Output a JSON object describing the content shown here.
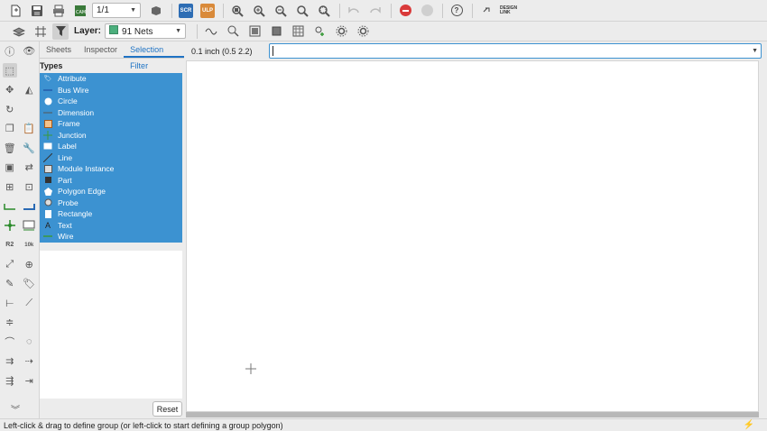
{
  "toolbar": {
    "sheet_value": "1/1",
    "scr_label": "SCR",
    "ulp_label": "ULP",
    "design_link_label": "DESIGN LINK"
  },
  "toolbar2": {
    "layer_label": "Layer:",
    "layer_value": "91 Nets",
    "layer_color": "#4caf7d"
  },
  "side_panel": {
    "tabs": [
      "Sheets",
      "Inspector",
      "Selection Filter"
    ],
    "active_tab": "Selection Filter",
    "types_header": "Types",
    "types": [
      {
        "label": "Attribute",
        "icon": "tag-icon"
      },
      {
        "label": "Bus Wire",
        "icon": "bus-wire-icon"
      },
      {
        "label": "Circle",
        "icon": "circle-icon"
      },
      {
        "label": "Dimension",
        "icon": "dimension-icon"
      },
      {
        "label": "Frame",
        "icon": "frame-icon"
      },
      {
        "label": "Junction",
        "icon": "junction-icon"
      },
      {
        "label": "Label",
        "icon": "label-icon"
      },
      {
        "label": "Line",
        "icon": "line-icon"
      },
      {
        "label": "Module Instance",
        "icon": "module-icon"
      },
      {
        "label": "Part",
        "icon": "part-icon"
      },
      {
        "label": "Polygon Edge",
        "icon": "polygon-icon"
      },
      {
        "label": "Probe",
        "icon": "probe-icon"
      },
      {
        "label": "Rectangle",
        "icon": "rectangle-icon"
      },
      {
        "label": "Text",
        "icon": "text-icon"
      },
      {
        "label": "Wire",
        "icon": "wire-icon"
      }
    ],
    "reset_label": "Reset",
    "selection_color": "#3c92d1"
  },
  "command": {
    "grid_label": "0.1 inch (0.5 2.2)",
    "input_value": ""
  },
  "statusbar": {
    "message": "Left-click & drag to define group (or left-click to start defining a group polygon)"
  }
}
